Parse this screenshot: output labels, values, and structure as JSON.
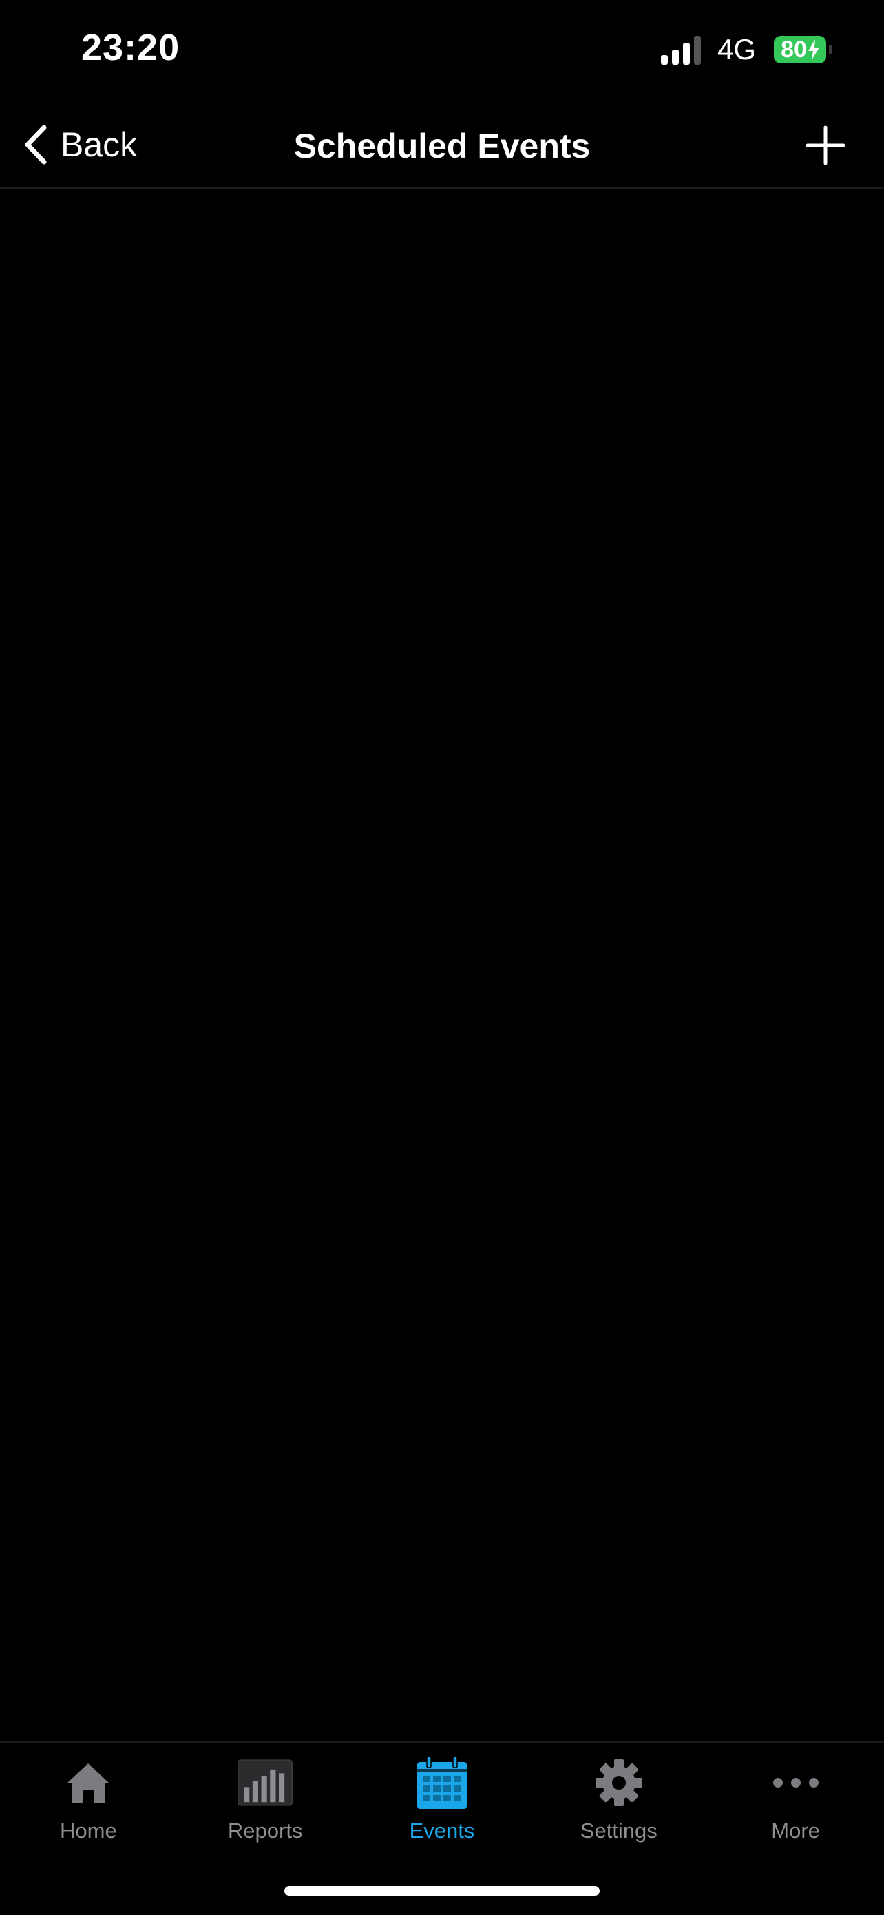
{
  "status_bar": {
    "time": "23:20",
    "network": "4G",
    "battery": "80"
  },
  "nav": {
    "back_label": "Back",
    "title": "Scheduled Events"
  },
  "tabs": [
    {
      "label": "Home",
      "icon": "home-icon",
      "active": false
    },
    {
      "label": "Reports",
      "icon": "reports-chart-icon",
      "active": false
    },
    {
      "label": "Events",
      "icon": "calendar-icon",
      "active": true
    },
    {
      "label": "Settings",
      "icon": "gear-icon",
      "active": false
    },
    {
      "label": "More",
      "icon": "more-dots-icon",
      "active": false
    }
  ],
  "colors": {
    "background": "#000000",
    "active_tab": "#1aa6e8",
    "inactive_tab": "#8e8e93",
    "battery": "#34c759"
  }
}
